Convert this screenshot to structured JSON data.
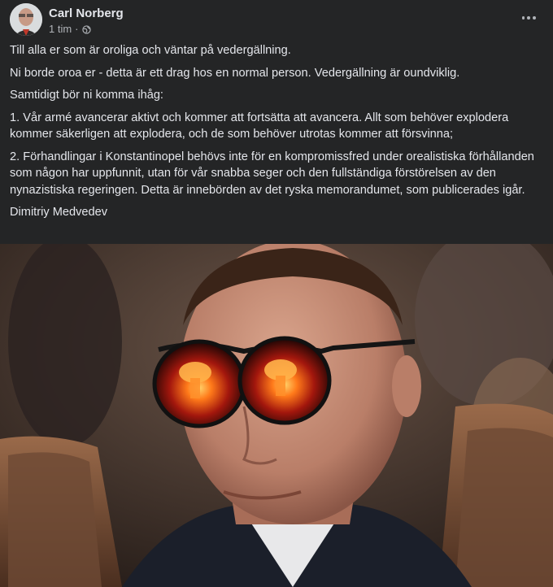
{
  "post": {
    "author": "Carl Norberg",
    "time": "1 tim",
    "separator": "·",
    "privacy_icon": "globe-icon",
    "paragraphs": [
      "Till alla er som är oroliga och väntar på vedergällning.",
      "Ni borde oroa er - detta är ett drag hos en normal person. Vedergällning är oundviklig.",
      "Samtidigt bör ni komma ihåg:",
      "1. Vår armé avancerar aktivt och kommer att fortsätta att avancera. Allt som behöver explodera kommer säkerligen att explodera, och de som behöver utrotas kommer att försvinna;",
      "2. Förhandlingar i Konstantinopel behövs inte för en kompromissfred under orealistiska förhållanden som någon har uppfunnit, utan för vår snabba seger och den fullständiga förstörelsen av den nynazistiska regeringen. Detta är innebörden av det ryska memorandumet, som publicerades igår.",
      "Dimitriy Medvedev"
    ]
  },
  "colors": {
    "background": "#242526",
    "text": "#e4e6eb",
    "secondary_text": "#b0b3b8"
  }
}
